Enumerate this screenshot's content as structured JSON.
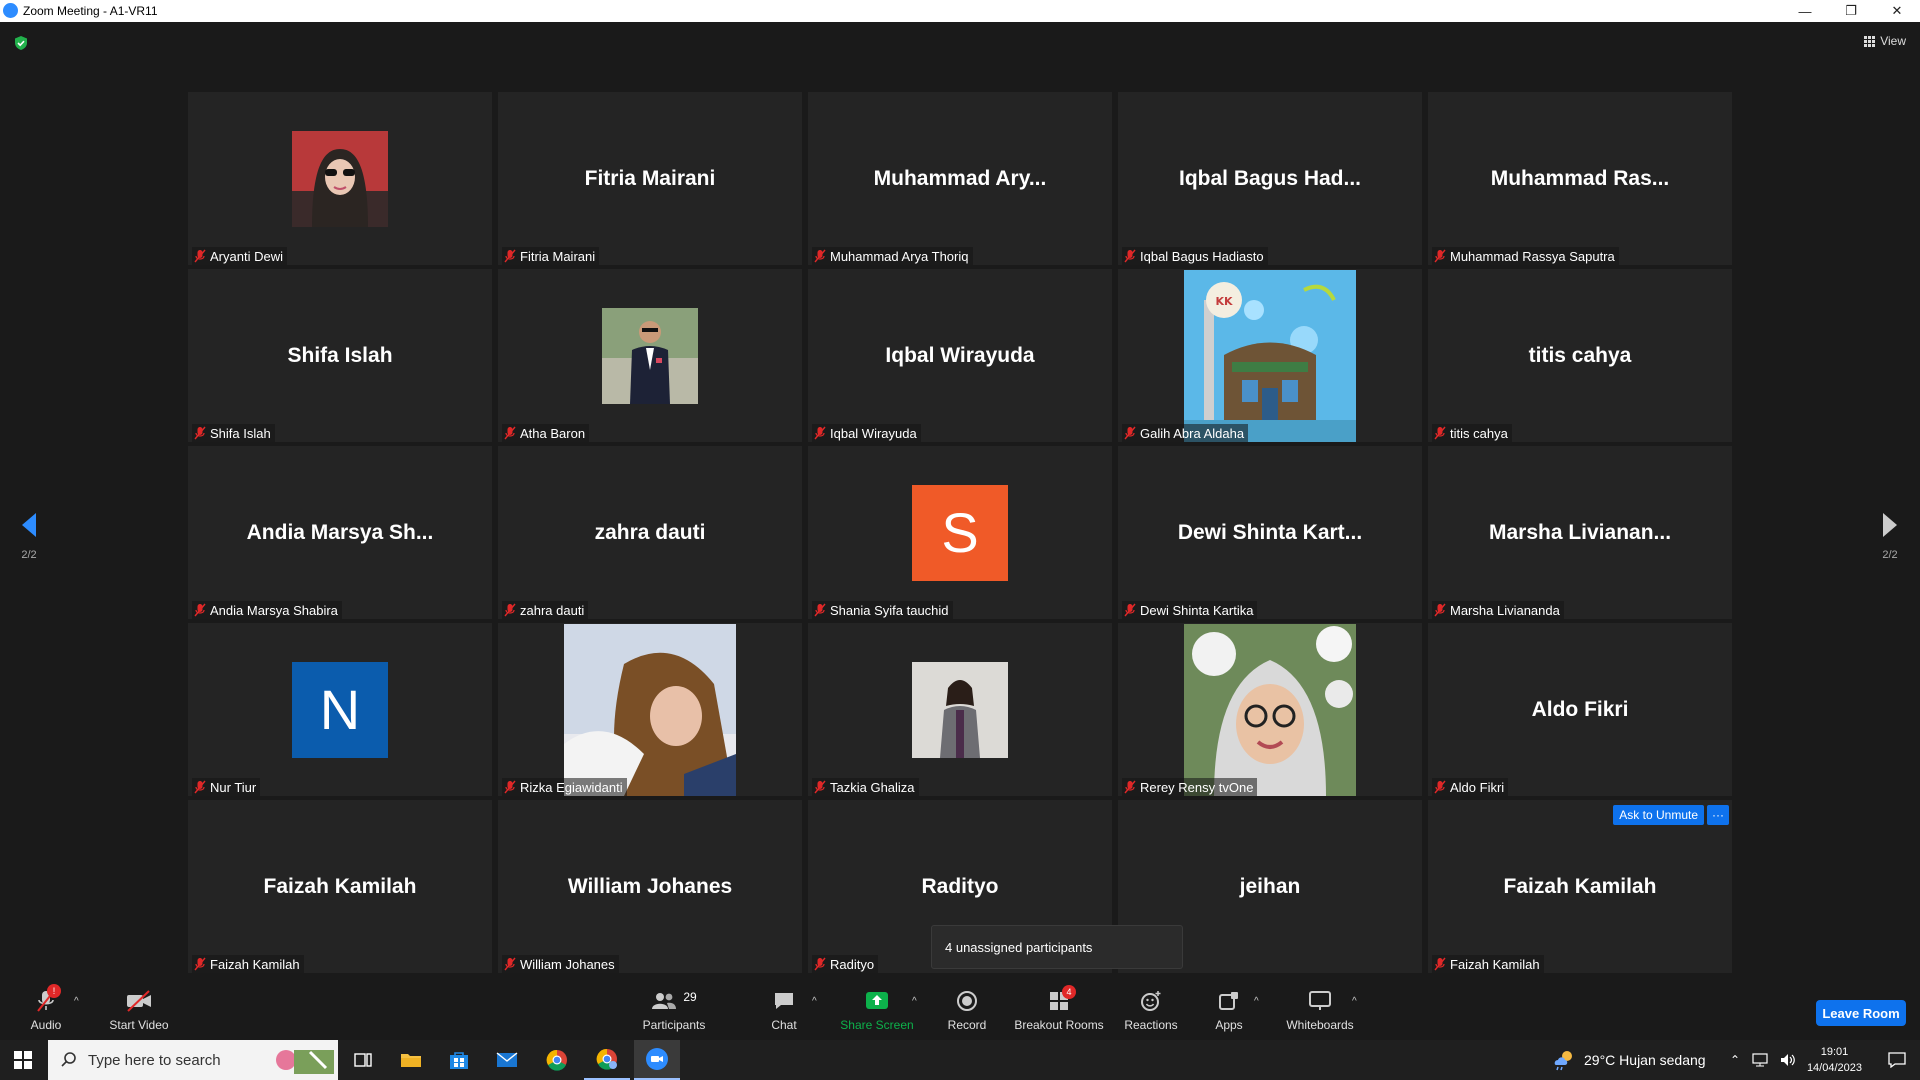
{
  "window": {
    "title": "Zoom Meeting - A1-VR11",
    "min": "—",
    "max": "❐",
    "close": "✕"
  },
  "meeting": {
    "view_label": "View",
    "page_left": "2/2",
    "page_right": "2/2",
    "tiles": [
      {
        "name": "Aryanti Dewi",
        "display": "",
        "type": "photo"
      },
      {
        "name": "Fitria Mairani",
        "display": "Fitria Mairani",
        "type": "text"
      },
      {
        "name": "Muhammad Arya Thoriq",
        "display": "Muhammad  Ary...",
        "type": "text"
      },
      {
        "name": "Iqbal Bagus Hadiasto",
        "display": "Iqbal Bagus Had...",
        "type": "text"
      },
      {
        "name": "Muhammad Rassya Saputra",
        "display": "Muhammad  Ras...",
        "type": "text"
      },
      {
        "name": "Shifa Islah",
        "display": "Shifa Islah",
        "type": "text"
      },
      {
        "name": "Atha Baron",
        "display": "",
        "type": "photo"
      },
      {
        "name": "Iqbal Wirayuda",
        "display": "Iqbal Wirayuda",
        "type": "text"
      },
      {
        "name": "Galih Abra Aldaha",
        "display": "",
        "type": "photo"
      },
      {
        "name": "titis cahya",
        "display": "titis cahya",
        "type": "text"
      },
      {
        "name": "Andia Marsya Shabira",
        "display": "Andia  Marsya  Sh...",
        "type": "text"
      },
      {
        "name": "zahra dauti",
        "display": "zahra dauti",
        "type": "text"
      },
      {
        "name": "Shania Syifa tauchid",
        "display": "S",
        "type": "letter",
        "color": "#f05a28"
      },
      {
        "name": "Dewi Shinta Kartika",
        "display": "Dewi Shinta Kart...",
        "type": "text"
      },
      {
        "name": "Marsha Liviananda",
        "display": "Marsha  Livianan...",
        "type": "text"
      },
      {
        "name": "Nur Tiur",
        "display": "N",
        "type": "letter",
        "color": "#0b5cad"
      },
      {
        "name": "Rizka Egiawidanti",
        "display": "",
        "type": "photo"
      },
      {
        "name": "Tazkia Ghaliza",
        "display": "",
        "type": "photo"
      },
      {
        "name": "Rerey Rensy tvOne",
        "display": "",
        "type": "photo"
      },
      {
        "name": "Aldo Fikri",
        "display": "Aldo Fikri",
        "type": "text"
      },
      {
        "name": "Faizah Kamilah",
        "display": "Faizah Kamilah",
        "type": "text"
      },
      {
        "name": "William Johanes",
        "display": "William Johanes",
        "type": "text"
      },
      {
        "name": "Radityo",
        "display": "Radityo",
        "type": "text"
      },
      {
        "name": "",
        "display": "jeihan",
        "type": "text"
      },
      {
        "name": "Faizah Kamilah",
        "display": "Faizah Kamilah",
        "type": "text"
      }
    ],
    "ask_to_unmute": "Ask to Unmute",
    "more_dots": "···",
    "popup": "4 unassigned participants"
  },
  "toolbar": {
    "audio": "Audio",
    "start_video": "Start Video",
    "participants": "Participants",
    "participants_count": "29",
    "chat": "Chat",
    "share_screen": "Share Screen",
    "record": "Record",
    "breakout_rooms": "Breakout Rooms",
    "breakout_badge": "4",
    "reactions": "Reactions",
    "apps": "Apps",
    "whiteboards": "Whiteboards",
    "leave_room": "Leave Room",
    "caret": "^"
  },
  "taskbar": {
    "search_placeholder": "Type here to search",
    "weather": "29°C  Hujan sedang",
    "time": "19:01",
    "date": "14/04/2023"
  },
  "colors": {
    "accent": "#0e72ed",
    "share_green": "#0db14b",
    "mute_red": "#e02828"
  }
}
